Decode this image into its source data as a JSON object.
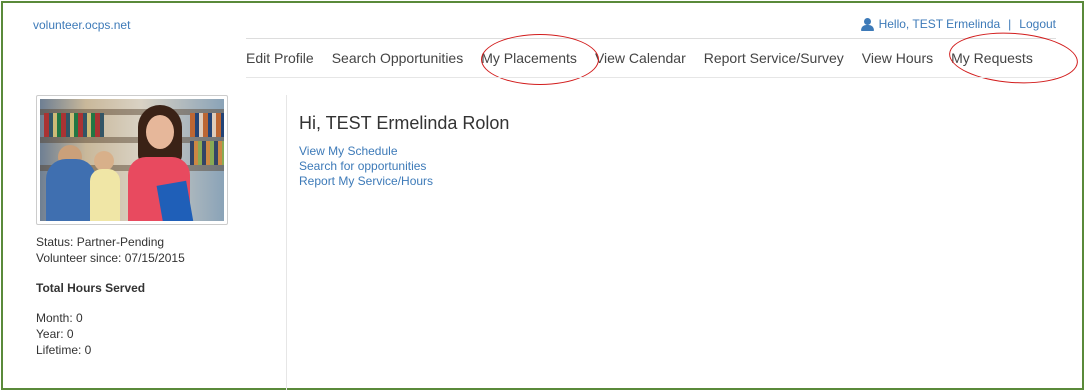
{
  "header": {
    "site": "volunteer.ocps.net",
    "hello": "Hello, TEST Ermelinda",
    "separator": "|",
    "logout": "Logout"
  },
  "nav": {
    "items": [
      "Edit Profile",
      "Search Opportunities",
      "My Placements",
      "View Calendar",
      "Report Service/Survey",
      "View Hours",
      "My Requests"
    ]
  },
  "profile": {
    "status": "Status: Partner-Pending",
    "since": "Volunteer since: 07/15/2015",
    "hours_heading": "Total Hours Served",
    "month": "Month: 0",
    "year": "Year: 0",
    "lifetime": "Lifetime: 0"
  },
  "main": {
    "greeting": "Hi, TEST Ermelinda Rolon",
    "links": [
      "View My Schedule",
      "Search for opportunities",
      "Report My Service/Hours"
    ]
  },
  "colors": {
    "link": "#3d7ab8",
    "annotation": "#d21d1d",
    "frame": "#5a8a3a"
  }
}
